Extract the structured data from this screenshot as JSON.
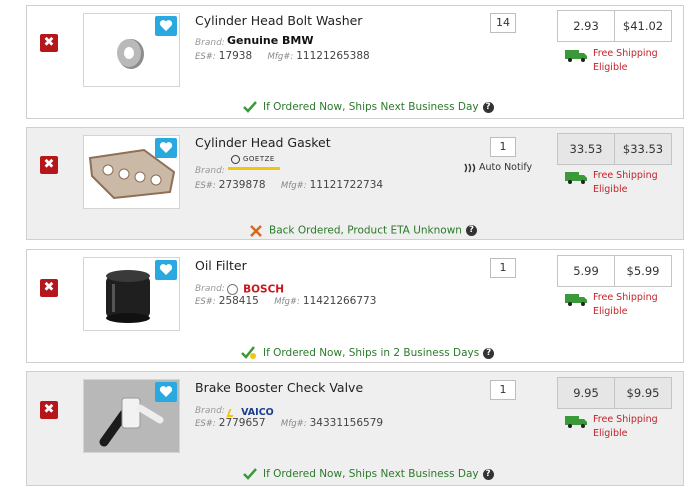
{
  "items": [
    {
      "title": "Cylinder Head Bolt Washer",
      "brand_label": "Brand:",
      "brand": "Genuine BMW",
      "es_label": "ES#:",
      "es": "17938",
      "mfg_label": "Mfg#:",
      "mfg": "11121265388",
      "quantity": "14",
      "unit_price": "2.93",
      "total_price": "$41.02",
      "shipping_line1": "Free Shipping",
      "shipping_line2": "Eligible",
      "status": "If Ordered Now, Ships Next Business Day",
      "status_icon": "check-icon"
    },
    {
      "title": "Cylinder Head Gasket",
      "brand_label": "Brand:",
      "brand": "GOETZE",
      "es_label": "ES#:",
      "es": "2739878",
      "mfg_label": "Mfg#:",
      "mfg": "11121722734",
      "quantity": "1",
      "notify_label": "Auto Notify",
      "unit_price": "33.53",
      "total_price": "$33.53",
      "shipping_line1": "Free Shipping",
      "shipping_line2": "Eligible",
      "status": "Back Ordered, Product ETA Unknown",
      "status_icon": "x-icon"
    },
    {
      "title": "Oil Filter",
      "brand_label": "Brand:",
      "brand": "BOSCH",
      "es_label": "ES#:",
      "es": "258415",
      "mfg_label": "Mfg#:",
      "mfg": "11421266773",
      "quantity": "1",
      "unit_price": "5.99",
      "total_price": "$5.99",
      "shipping_line1": "Free Shipping",
      "shipping_line2": "Eligible",
      "status": "If Ordered Now, Ships in 2 Business Days",
      "status_icon": "check-clock-icon"
    },
    {
      "title": "Brake Booster Check Valve",
      "brand_label": "Brand:",
      "brand": "VAICO",
      "es_label": "ES#:",
      "es": "2779657",
      "mfg_label": "Mfg#:",
      "mfg": "34331156579",
      "quantity": "1",
      "unit_price": "9.95",
      "total_price": "$9.95",
      "shipping_line1": "Free Shipping",
      "shipping_line2": "Eligible",
      "status": "If Ordered Now, Ships Next Business Day",
      "status_icon": "check-icon"
    }
  ],
  "help_symbol": "?",
  "remove_symbol": "✖",
  "colors": {
    "remove_red": "#b5161b",
    "favorite_blue": "#2aa9e0",
    "shipping_red": "#c0232b",
    "truck_green": "#3a9a3a",
    "status_green": "#2a7a2a",
    "row_grey": "#efefef"
  }
}
